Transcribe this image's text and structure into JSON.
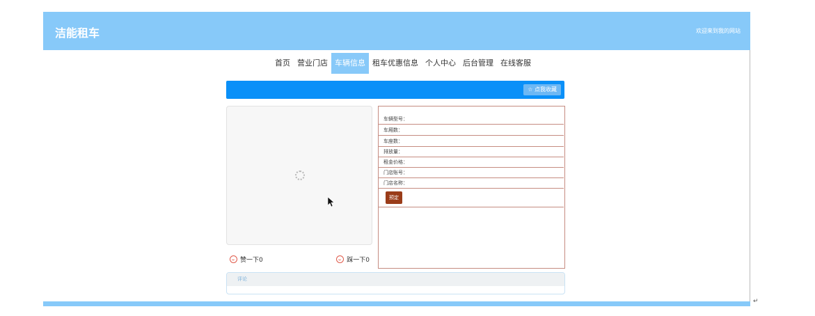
{
  "header": {
    "brand": "洁能租车",
    "welcome": "欢迎来到我的网站"
  },
  "nav": {
    "items": [
      {
        "label": "首页",
        "active": false
      },
      {
        "label": "营业门店",
        "active": false
      },
      {
        "label": "车辆信息",
        "active": true
      },
      {
        "label": "租车优惠信息",
        "active": false
      },
      {
        "label": "个人中心",
        "active": false
      },
      {
        "label": "后台管理",
        "active": false
      },
      {
        "label": "在线客服",
        "active": false
      }
    ]
  },
  "toolbar": {
    "favorite_label": "☆ 点我收藏"
  },
  "reactions": {
    "like_label": "赞一下0",
    "dislike_label": "踩一下0"
  },
  "details": {
    "fields": [
      {
        "label": "车辆型号："
      },
      {
        "label": "车厢数："
      },
      {
        "label": "车座数："
      },
      {
        "label": "排放量："
      },
      {
        "label": "租金价格："
      },
      {
        "label": "门店账号："
      },
      {
        "label": "门店名称："
      }
    ],
    "book_label": "预定"
  },
  "comments": {
    "title": "评论"
  },
  "misc": {
    "return_mark": "↵"
  },
  "colors": {
    "header": "#87c9f9",
    "bar": "#0a90f8",
    "book_button": "#9a3c19",
    "panel_border": "#c58b80"
  }
}
